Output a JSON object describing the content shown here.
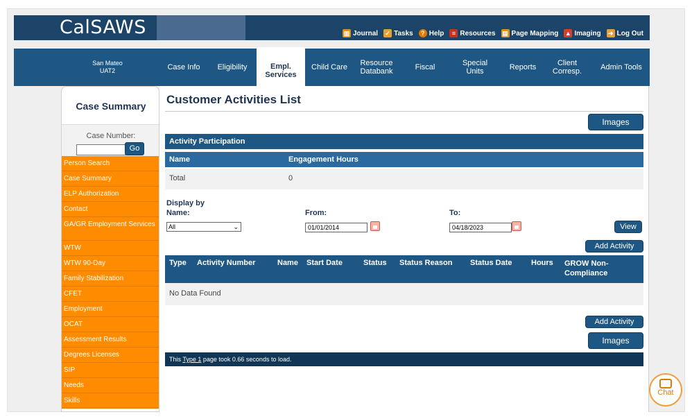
{
  "header": {
    "logo": "CalSAWS",
    "top_links": [
      {
        "label": "Journal",
        "icon": "journal-icon",
        "color": "#d89020"
      },
      {
        "label": "Tasks",
        "icon": "tasks-icon",
        "color": "#e8a030"
      },
      {
        "label": "Help",
        "icon": "help-icon",
        "color": "#e07a00"
      },
      {
        "label": "Resources",
        "icon": "resources-icon",
        "color": "#c83020"
      },
      {
        "label": "Page Mapping",
        "icon": "page-mapping-icon",
        "color": "#d89020"
      },
      {
        "label": "Imaging",
        "icon": "imaging-icon",
        "color": "#d84020"
      },
      {
        "label": "Log Out",
        "icon": "logout-icon",
        "color": "#e8a030"
      }
    ],
    "county": "San Mateo",
    "environment": "UAT2"
  },
  "nav": {
    "tabs": [
      "Case Info",
      "Eligibility",
      "Empl. Services",
      "Child Care",
      "Resource Databank",
      "Fiscal",
      "Special Units",
      "Reports",
      "Client Corresp.",
      "Admin Tools"
    ],
    "active": "Empl. Services"
  },
  "sidebar": {
    "title": "Case Summary",
    "case_number_label": "Case Number:",
    "case_number_value": "",
    "go_label": "Go",
    "items": [
      "Person Search",
      "Case Summary",
      "ELP Authorization",
      "Contact",
      "GA/GR Employment Services",
      "WTW",
      "WTW 90-Day",
      "Family Stabilization",
      "CFET",
      "Employment",
      "OCAT",
      "Assessment Results",
      "Degrees Licenses",
      "SIP",
      "Needs",
      "Skills"
    ]
  },
  "main": {
    "title": "Customer Activities List",
    "images_label": "Images",
    "activity_participation": {
      "header": "Activity Participation",
      "col_name": "Name",
      "col_hours": "Engagement Hours",
      "total_label": "Total",
      "total_value": "0"
    },
    "filters": {
      "display_by_label": "Display by",
      "name_label": "Name:",
      "name_value": "All",
      "from_label": "From:",
      "from_value": "01/01/2014",
      "to_label": "To:",
      "to_value": "04/18/2023",
      "view_label": "View"
    },
    "add_activity_label": "Add Activity",
    "activities_table": {
      "columns": [
        "Type",
        "Activity Number",
        "Name",
        "Start Date",
        "Status",
        "Status Reason",
        "Status Date",
        "Hours",
        "GROW Non-Compliance"
      ],
      "empty_text": "No Data Found"
    },
    "footer": {
      "prefix": "This ",
      "link": "Type 1",
      "suffix": " page took 0.66 seconds to load."
    }
  },
  "chat_label": "Chat",
  "colors": {
    "primary": "#1f5784",
    "dark": "#1b4468",
    "orange": "#ff8c00"
  }
}
